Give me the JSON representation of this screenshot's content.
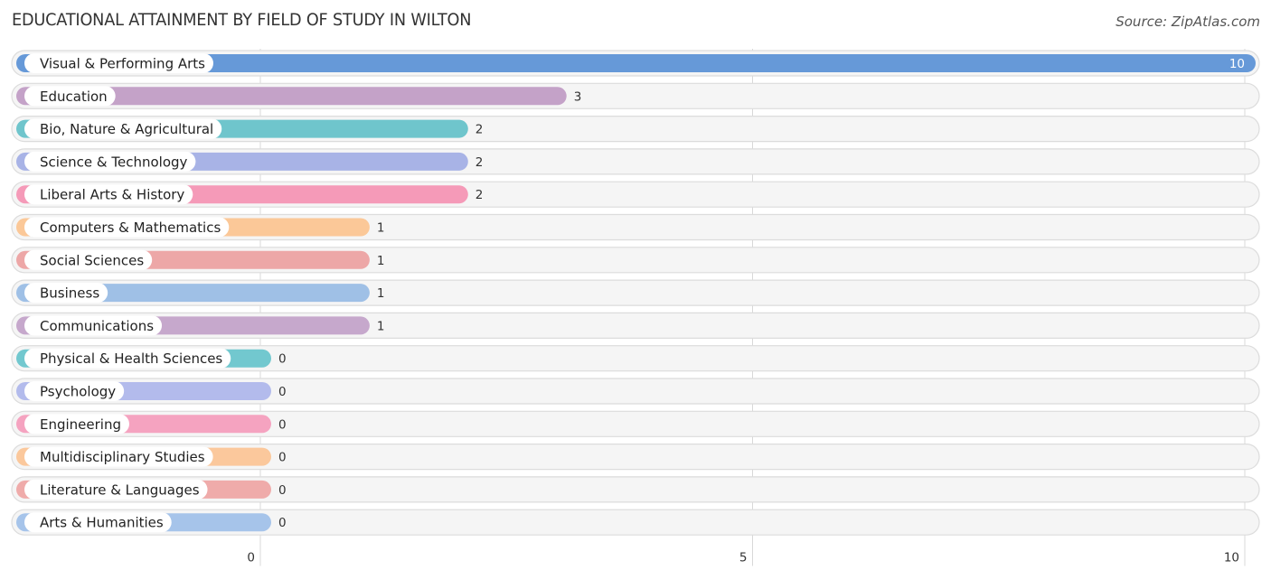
{
  "header": {
    "title": "EDUCATIONAL ATTAINMENT BY FIELD OF STUDY IN WILTON",
    "source": "Source: ZipAtlas.com"
  },
  "chart_data": {
    "type": "bar",
    "orientation": "horizontal",
    "title": "EDUCATIONAL ATTAINMENT BY FIELD OF STUDY IN WILTON",
    "xlabel": "",
    "ylabel": "",
    "xlim": [
      0,
      10
    ],
    "x_ticks": [
      0,
      5,
      10
    ],
    "x_tick_labels": [
      "0",
      "5",
      "10"
    ],
    "grid": true,
    "legend": "none",
    "categories": [
      "Visual & Performing Arts",
      "Education",
      "Bio, Nature & Agricultural",
      "Science & Technology",
      "Liberal Arts & History",
      "Computers & Mathematics",
      "Social Sciences",
      "Business",
      "Communications",
      "Physical & Health Sciences",
      "Psychology",
      "Engineering",
      "Multidisciplinary Studies",
      "Literature & Languages",
      "Arts & Humanities"
    ],
    "values": [
      10,
      3,
      2,
      2,
      2,
      1,
      1,
      1,
      1,
      0,
      0,
      0,
      0,
      0,
      0
    ],
    "colors": [
      "#6699d8",
      "#c4a2c8",
      "#6fc5cc",
      "#a8b3e6",
      "#f59ab8",
      "#fbc898",
      "#eda7a7",
      "#9fc0e6",
      "#c6a8cc",
      "#72c8cf",
      "#b3bbec",
      "#f5a3c0",
      "#fbc89c",
      "#efabaa",
      "#a6c4ea"
    ]
  }
}
